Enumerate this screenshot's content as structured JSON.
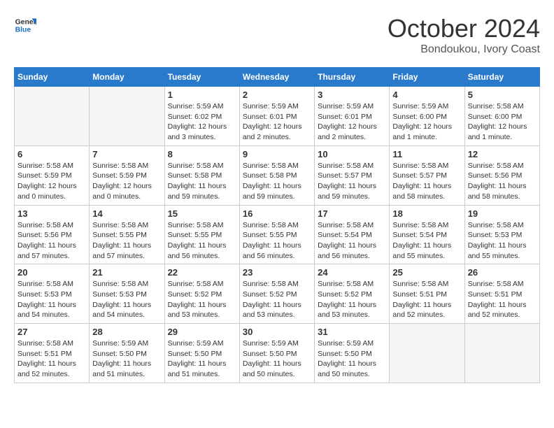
{
  "logo": {
    "text_general": "General",
    "text_blue": "Blue"
  },
  "header": {
    "month": "October 2024",
    "location": "Bondoukou, Ivory Coast"
  },
  "weekdays": [
    "Sunday",
    "Monday",
    "Tuesday",
    "Wednesday",
    "Thursday",
    "Friday",
    "Saturday"
  ],
  "weeks": [
    [
      {
        "day": "",
        "info": ""
      },
      {
        "day": "",
        "info": ""
      },
      {
        "day": "1",
        "sunrise": "Sunrise: 5:59 AM",
        "sunset": "Sunset: 6:02 PM",
        "daylight": "Daylight: 12 hours and 3 minutes."
      },
      {
        "day": "2",
        "sunrise": "Sunrise: 5:59 AM",
        "sunset": "Sunset: 6:01 PM",
        "daylight": "Daylight: 12 hours and 2 minutes."
      },
      {
        "day": "3",
        "sunrise": "Sunrise: 5:59 AM",
        "sunset": "Sunset: 6:01 PM",
        "daylight": "Daylight: 12 hours and 2 minutes."
      },
      {
        "day": "4",
        "sunrise": "Sunrise: 5:59 AM",
        "sunset": "Sunset: 6:00 PM",
        "daylight": "Daylight: 12 hours and 1 minute."
      },
      {
        "day": "5",
        "sunrise": "Sunrise: 5:58 AM",
        "sunset": "Sunset: 6:00 PM",
        "daylight": "Daylight: 12 hours and 1 minute."
      }
    ],
    [
      {
        "day": "6",
        "sunrise": "Sunrise: 5:58 AM",
        "sunset": "Sunset: 5:59 PM",
        "daylight": "Daylight: 12 hours and 0 minutes."
      },
      {
        "day": "7",
        "sunrise": "Sunrise: 5:58 AM",
        "sunset": "Sunset: 5:59 PM",
        "daylight": "Daylight: 12 hours and 0 minutes."
      },
      {
        "day": "8",
        "sunrise": "Sunrise: 5:58 AM",
        "sunset": "Sunset: 5:58 PM",
        "daylight": "Daylight: 11 hours and 59 minutes."
      },
      {
        "day": "9",
        "sunrise": "Sunrise: 5:58 AM",
        "sunset": "Sunset: 5:58 PM",
        "daylight": "Daylight: 11 hours and 59 minutes."
      },
      {
        "day": "10",
        "sunrise": "Sunrise: 5:58 AM",
        "sunset": "Sunset: 5:57 PM",
        "daylight": "Daylight: 11 hours and 59 minutes."
      },
      {
        "day": "11",
        "sunrise": "Sunrise: 5:58 AM",
        "sunset": "Sunset: 5:57 PM",
        "daylight": "Daylight: 11 hours and 58 minutes."
      },
      {
        "day": "12",
        "sunrise": "Sunrise: 5:58 AM",
        "sunset": "Sunset: 5:56 PM",
        "daylight": "Daylight: 11 hours and 58 minutes."
      }
    ],
    [
      {
        "day": "13",
        "sunrise": "Sunrise: 5:58 AM",
        "sunset": "Sunset: 5:56 PM",
        "daylight": "Daylight: 11 hours and 57 minutes."
      },
      {
        "day": "14",
        "sunrise": "Sunrise: 5:58 AM",
        "sunset": "Sunset: 5:55 PM",
        "daylight": "Daylight: 11 hours and 57 minutes."
      },
      {
        "day": "15",
        "sunrise": "Sunrise: 5:58 AM",
        "sunset": "Sunset: 5:55 PM",
        "daylight": "Daylight: 11 hours and 56 minutes."
      },
      {
        "day": "16",
        "sunrise": "Sunrise: 5:58 AM",
        "sunset": "Sunset: 5:55 PM",
        "daylight": "Daylight: 11 hours and 56 minutes."
      },
      {
        "day": "17",
        "sunrise": "Sunrise: 5:58 AM",
        "sunset": "Sunset: 5:54 PM",
        "daylight": "Daylight: 11 hours and 56 minutes."
      },
      {
        "day": "18",
        "sunrise": "Sunrise: 5:58 AM",
        "sunset": "Sunset: 5:54 PM",
        "daylight": "Daylight: 11 hours and 55 minutes."
      },
      {
        "day": "19",
        "sunrise": "Sunrise: 5:58 AM",
        "sunset": "Sunset: 5:53 PM",
        "daylight": "Daylight: 11 hours and 55 minutes."
      }
    ],
    [
      {
        "day": "20",
        "sunrise": "Sunrise: 5:58 AM",
        "sunset": "Sunset: 5:53 PM",
        "daylight": "Daylight: 11 hours and 54 minutes."
      },
      {
        "day": "21",
        "sunrise": "Sunrise: 5:58 AM",
        "sunset": "Sunset: 5:53 PM",
        "daylight": "Daylight: 11 hours and 54 minutes."
      },
      {
        "day": "22",
        "sunrise": "Sunrise: 5:58 AM",
        "sunset": "Sunset: 5:52 PM",
        "daylight": "Daylight: 11 hours and 53 minutes."
      },
      {
        "day": "23",
        "sunrise": "Sunrise: 5:58 AM",
        "sunset": "Sunset: 5:52 PM",
        "daylight": "Daylight: 11 hours and 53 minutes."
      },
      {
        "day": "24",
        "sunrise": "Sunrise: 5:58 AM",
        "sunset": "Sunset: 5:52 PM",
        "daylight": "Daylight: 11 hours and 53 minutes."
      },
      {
        "day": "25",
        "sunrise": "Sunrise: 5:58 AM",
        "sunset": "Sunset: 5:51 PM",
        "daylight": "Daylight: 11 hours and 52 minutes."
      },
      {
        "day": "26",
        "sunrise": "Sunrise: 5:58 AM",
        "sunset": "Sunset: 5:51 PM",
        "daylight": "Daylight: 11 hours and 52 minutes."
      }
    ],
    [
      {
        "day": "27",
        "sunrise": "Sunrise: 5:58 AM",
        "sunset": "Sunset: 5:51 PM",
        "daylight": "Daylight: 11 hours and 52 minutes."
      },
      {
        "day": "28",
        "sunrise": "Sunrise: 5:59 AM",
        "sunset": "Sunset: 5:50 PM",
        "daylight": "Daylight: 11 hours and 51 minutes."
      },
      {
        "day": "29",
        "sunrise": "Sunrise: 5:59 AM",
        "sunset": "Sunset: 5:50 PM",
        "daylight": "Daylight: 11 hours and 51 minutes."
      },
      {
        "day": "30",
        "sunrise": "Sunrise: 5:59 AM",
        "sunset": "Sunset: 5:50 PM",
        "daylight": "Daylight: 11 hours and 50 minutes."
      },
      {
        "day": "31",
        "sunrise": "Sunrise: 5:59 AM",
        "sunset": "Sunset: 5:50 PM",
        "daylight": "Daylight: 11 hours and 50 minutes."
      },
      {
        "day": "",
        "info": ""
      },
      {
        "day": "",
        "info": ""
      }
    ]
  ]
}
